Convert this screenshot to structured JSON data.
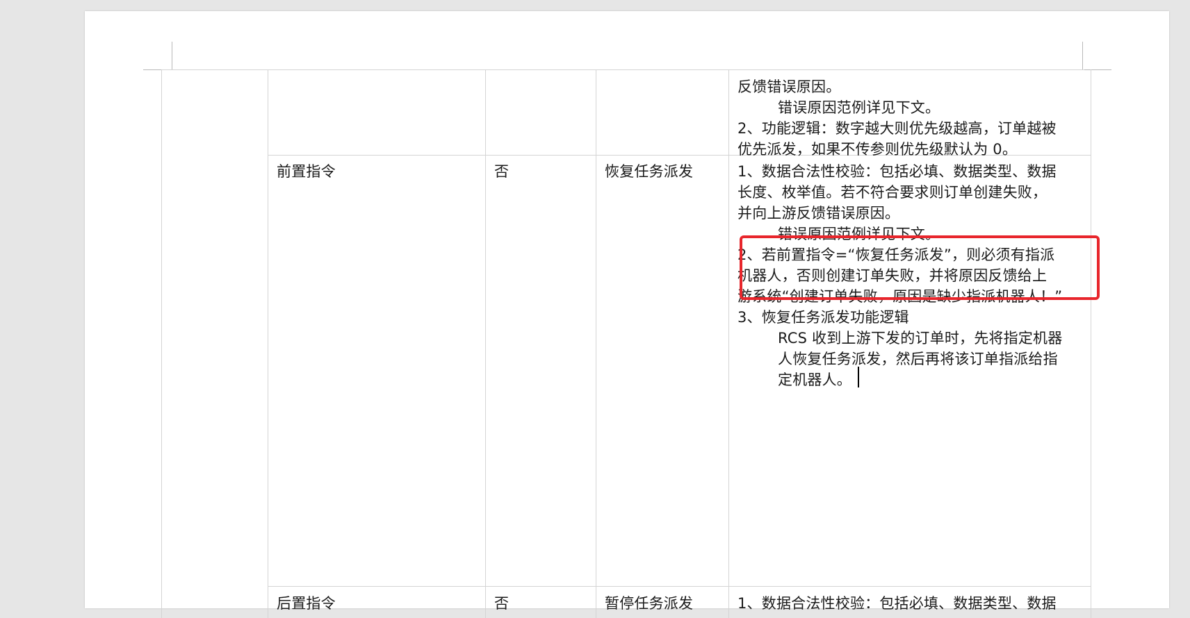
{
  "prev_row": {
    "desc": [
      "反馈错误原因。",
      "错误原因范例详见下文。",
      "2、功能逻辑：数字越大则优先级越高，订单越被",
      "优先派发，如果不传参则优先级默认为 0。"
    ]
  },
  "row_pre": {
    "name": "前置指令",
    "required": "否",
    "value": "恢复任务派发",
    "desc": [
      "1、数据合法性校验：包括必填、数据类型、数据",
      "长度、枚举值。若不符合要求则订单创建失败，",
      "并向上游反馈错误原因。",
      "错误原因范例详见下文。",
      "2、若前置指令=“恢复任务派发”，则必须有指派",
      "机器人，否则创建订单失败，并将原因反馈给上",
      "游系统“创建订单失败，原因是缺少指派机器人！”",
      "3、恢复任务派发功能逻辑",
      "RCS 收到上游下发的订单时，先将指定机器",
      "人恢复任务派发，然后再将该订单指派给指",
      "定机器人。"
    ]
  },
  "row_post": {
    "name": "后置指令",
    "required": "否",
    "value": "暂停任务派发",
    "desc": [
      "1、数据合法性校验：包括必填、数据类型、数据"
    ]
  },
  "colors": {
    "highlight_border": "#e8262c",
    "grid": "#d4d4d4",
    "page_bg": "#ffffff",
    "app_bg": "#e6e6e6"
  }
}
